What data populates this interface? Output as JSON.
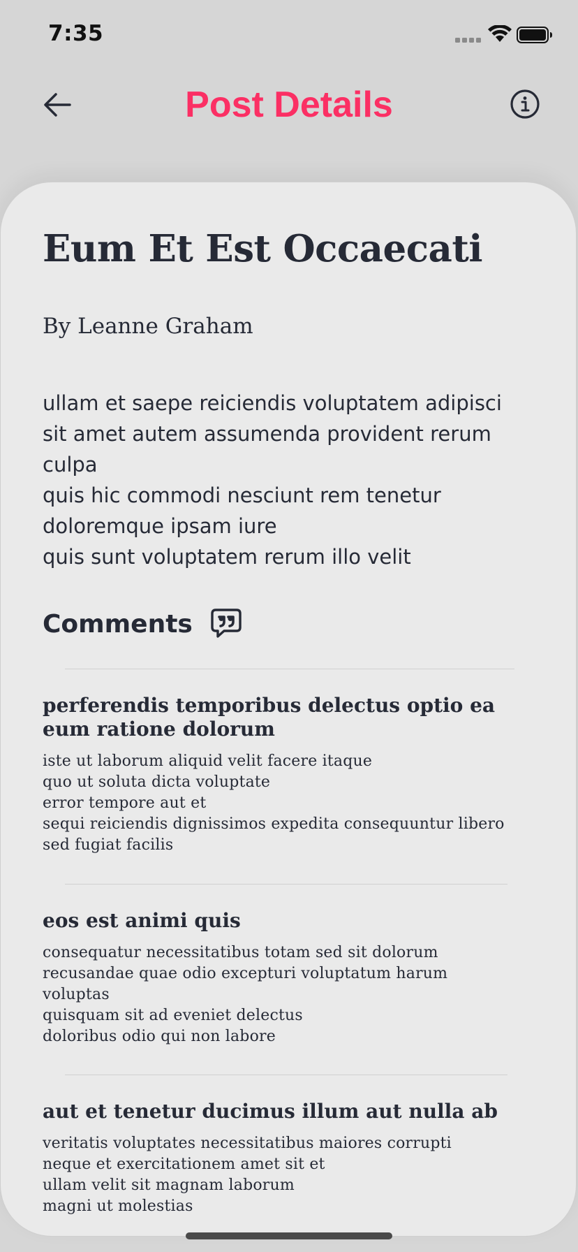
{
  "status_bar": {
    "time": "7:35"
  },
  "nav": {
    "title": "Post Details",
    "back_icon": "arrow-left-icon",
    "info_icon": "info-circle-icon",
    "title_color": "#fb2f64"
  },
  "post": {
    "title": "Eum Et Est Occaecati",
    "author": "By Leanne Graham",
    "body": "ullam et saepe reiciendis voluptatem adipisci\nsit amet autem assumenda provident rerum\nculpa\nquis hic commodi nesciunt rem tenetur\ndoloremque ipsam iure\nquis sunt voluptatem rerum illo velit"
  },
  "comments": {
    "heading": "Comments",
    "icon": "quote-chat-icon",
    "items": [
      {
        "title": "perferendis temporibus delectus optio ea eum ratione dolorum",
        "body": "iste ut laborum aliquid velit facere itaque\nquo ut soluta dicta voluptate\nerror tempore aut et\nsequi reiciendis dignissimos expedita consequuntur libero\nsed fugiat facilis"
      },
      {
        "title": "eos est animi quis",
        "body": "consequatur necessitatibus totam sed sit dolorum\nrecusandae quae odio excepturi voluptatum harum\nvoluptas\nquisquam sit ad eveniet delectus\ndoloribus odio qui non labore"
      },
      {
        "title": "aut et tenetur ducimus illum aut nulla ab",
        "body": "veritatis voluptates necessitatibus maiores corrupti\nneque et exercitationem amet sit et\nullam velit sit magnam laborum\nmagni ut molestias"
      }
    ]
  }
}
